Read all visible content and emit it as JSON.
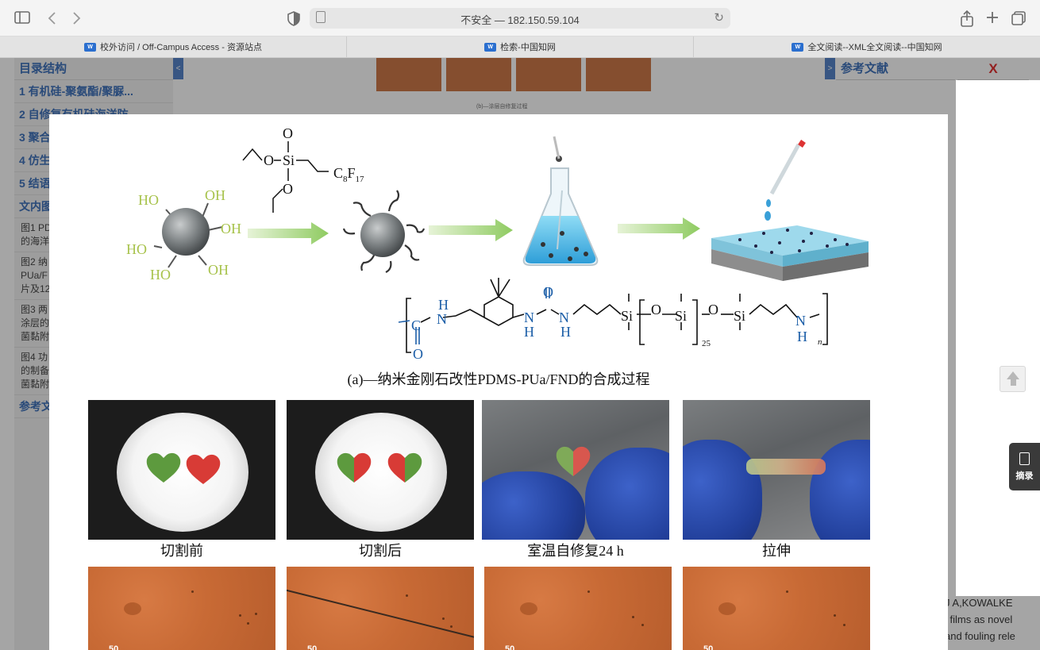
{
  "browser": {
    "url": "不安全 — 182.150.59.104",
    "tabs": [
      {
        "label": "校外访问 / Off-Campus Access - 资源站点"
      },
      {
        "label": "检索-中国知网"
      },
      {
        "label": "全文阅读--XML全文阅读--中国知网"
      }
    ]
  },
  "left_panel": {
    "title": "目录结构",
    "toc": [
      "1 有机硅-聚氨酯/聚脲...",
      "2 自修复有机硅海洋防",
      "3 聚合",
      "4 仿生",
      "5 结语",
      "文内图"
    ],
    "figures": [
      {
        "l1": "图1 PD",
        "l2": "的海洋"
      },
      {
        "l1": "图2 纳",
        "l2": "PUa/F",
        "l3": "片及12"
      },
      {
        "l1": "图3 两",
        "l2": "涂层的",
        "l3": "菌黏附"
      },
      {
        "l1": "图4 功",
        "l2": "的制备",
        "l3": "菌黏附"
      }
    ],
    "refs_item": "参考文"
  },
  "right_panel": {
    "title": "参考文献",
    "close": "X",
    "ref_lines": [
      "J A,KOWALKE",
      "l films as novel",
      "and fouling rele"
    ]
  },
  "abstract_button": {
    "label": "摘录"
  },
  "figure": {
    "caption_a": "(a)—纳米金刚石改性PDMS-PUa/FND的合成过程",
    "scheme": {
      "ho_labels": [
        "HO",
        "OH",
        "OH",
        "HO",
        "HO",
        "OH"
      ],
      "silane_o_top": "O",
      "silane_o_left": "O",
      "silane_si": "Si",
      "silane_o_bottom": "O",
      "silane_chain": "C",
      "silane_sub1": "8",
      "silane_f": "F",
      "silane_sub2": "17"
    },
    "polymer": {
      "c": "C",
      "o_bottom": "O",
      "nh1_h": "H",
      "nh1_n": "N",
      "nh2_n": "N",
      "nh2_h": "H",
      "o_top": "O",
      "nh3_n": "N",
      "nh3_h": "H",
      "si1": "Si",
      "o1": "O",
      "si2": "Si",
      "repeat": "25",
      "o2": "O",
      "si3": "Si",
      "nh4_n": "N",
      "nh4_h": "H",
      "n": "n"
    },
    "photo_labels": [
      "切割前",
      "切割后",
      "室温自修复24 h",
      "拉伸"
    ],
    "micro_scale": "50"
  },
  "bg_caption": "(b)—涂层自修复过程",
  "colors": {
    "accent": "#2a62b3",
    "green_arrow": "#9fd06f",
    "ho_green": "#a7c24b",
    "polymer_blue": "#1d5fa8",
    "close": "#e01a1a"
  },
  "icons": [
    "sidebar-icon",
    "back-icon",
    "forward-icon",
    "shield-icon",
    "page-icon",
    "reload-icon",
    "share-icon",
    "new-tab-icon",
    "tab-overview-icon",
    "up-arrow-icon",
    "abstract-doc-icon"
  ]
}
